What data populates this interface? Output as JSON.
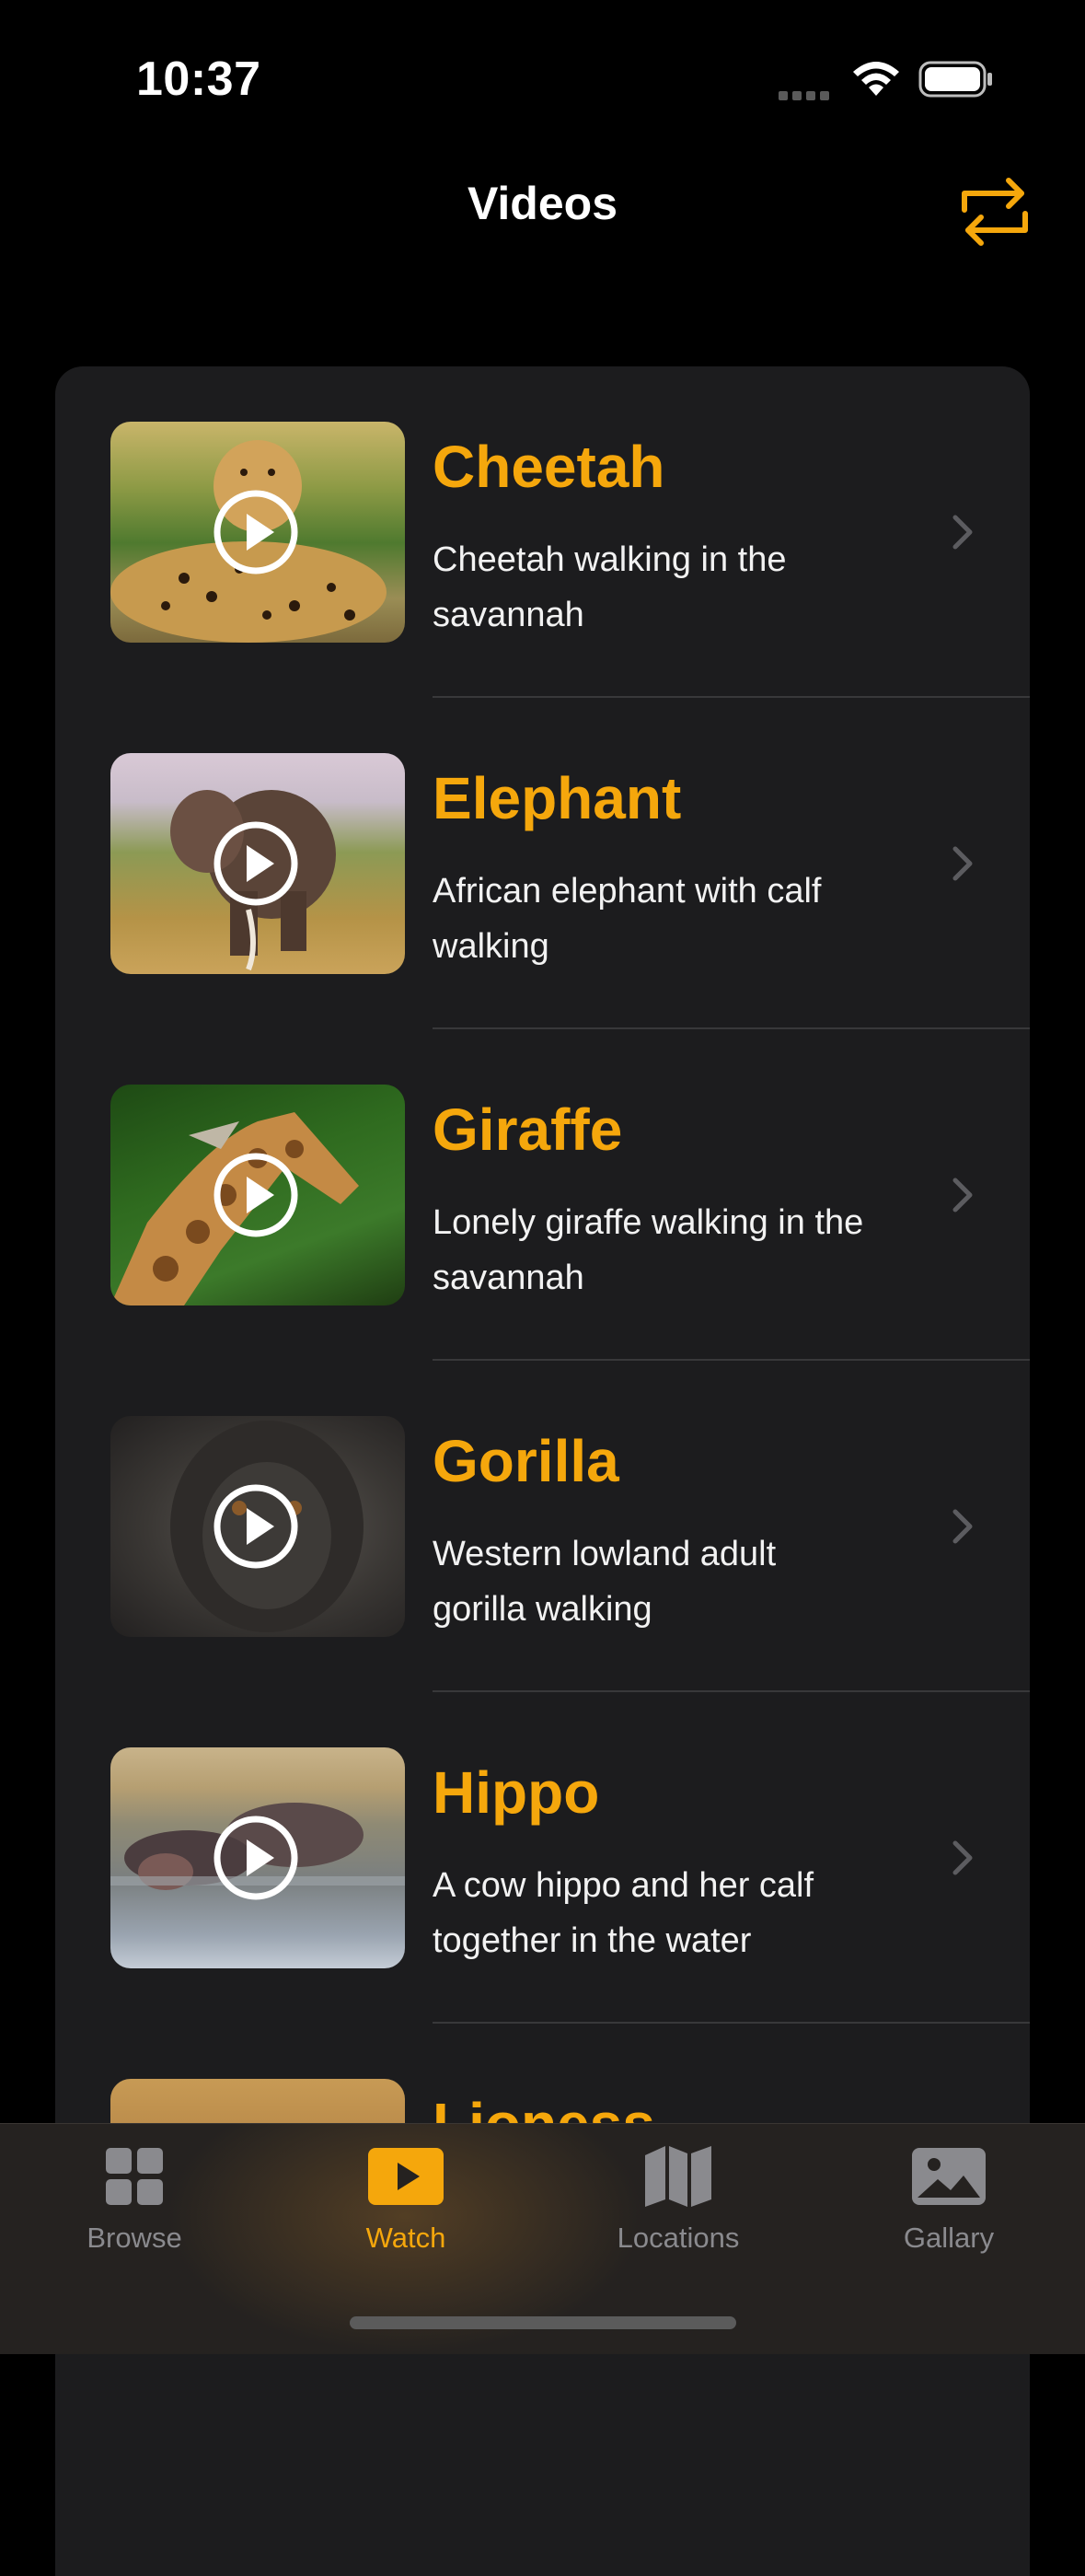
{
  "status": {
    "time": "10:37"
  },
  "nav": {
    "title": "Videos"
  },
  "videos": [
    {
      "title": "Cheetah",
      "description": "Cheetah walking in the savannah"
    },
    {
      "title": "Elephant",
      "description": "African elephant with calf walking"
    },
    {
      "title": "Giraffe",
      "description": "Lonely giraffe walking in the savannah"
    },
    {
      "title": "Gorilla",
      "description": "Western lowland adult gorilla walking"
    },
    {
      "title": "Hippo",
      "description": "A cow hippo and her calf together in the water"
    },
    {
      "title": "Lioness",
      "description": ""
    }
  ],
  "tabs": [
    {
      "label": "Browse",
      "icon": "grid-icon",
      "active": false
    },
    {
      "label": "Watch",
      "icon": "play-rectangle-icon",
      "active": true
    },
    {
      "label": "Locations",
      "icon": "map-icon",
      "active": false
    },
    {
      "label": "Gallary",
      "icon": "photo-icon",
      "active": false
    }
  ],
  "colors": {
    "accent": "#F5A70C",
    "background": "#000000",
    "card": "#1C1C1E"
  }
}
